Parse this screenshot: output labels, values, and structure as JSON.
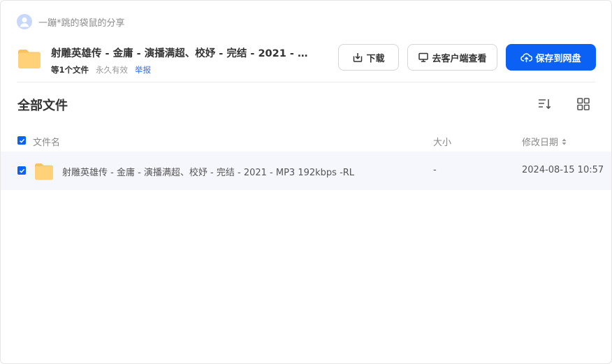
{
  "sharer": {
    "avatar_icon": "user-avatar-icon",
    "text": "一蹦*跳的袋鼠的分享"
  },
  "share": {
    "title": "射雕英雄传 - 金庸 - 演播满超、校妤 - 完结 - 2021 - MP3 192kbps -RL",
    "file_count": "等1个文件",
    "validity": "永久有效",
    "report_label": "举报"
  },
  "actions": {
    "download_label": "下载",
    "client_label": "去客户端查看",
    "save_label": "保存到网盘",
    "primary_color": "#0c61f5"
  },
  "section": {
    "title": "全部文件",
    "sort_icon": "sort-icon",
    "grid_icon": "grid-view-icon"
  },
  "table": {
    "columns": {
      "name": "文件名",
      "size": "大小",
      "date": "修改日期"
    },
    "rows": [
      {
        "name": "射雕英雄传 - 金庸 - 演播满超、校妤 - 完结 - 2021 - MP3 192kbps -RL",
        "size": "-",
        "date": "2024-08-15 10:57",
        "checked": true,
        "icon": "folder-icon"
      }
    ]
  }
}
